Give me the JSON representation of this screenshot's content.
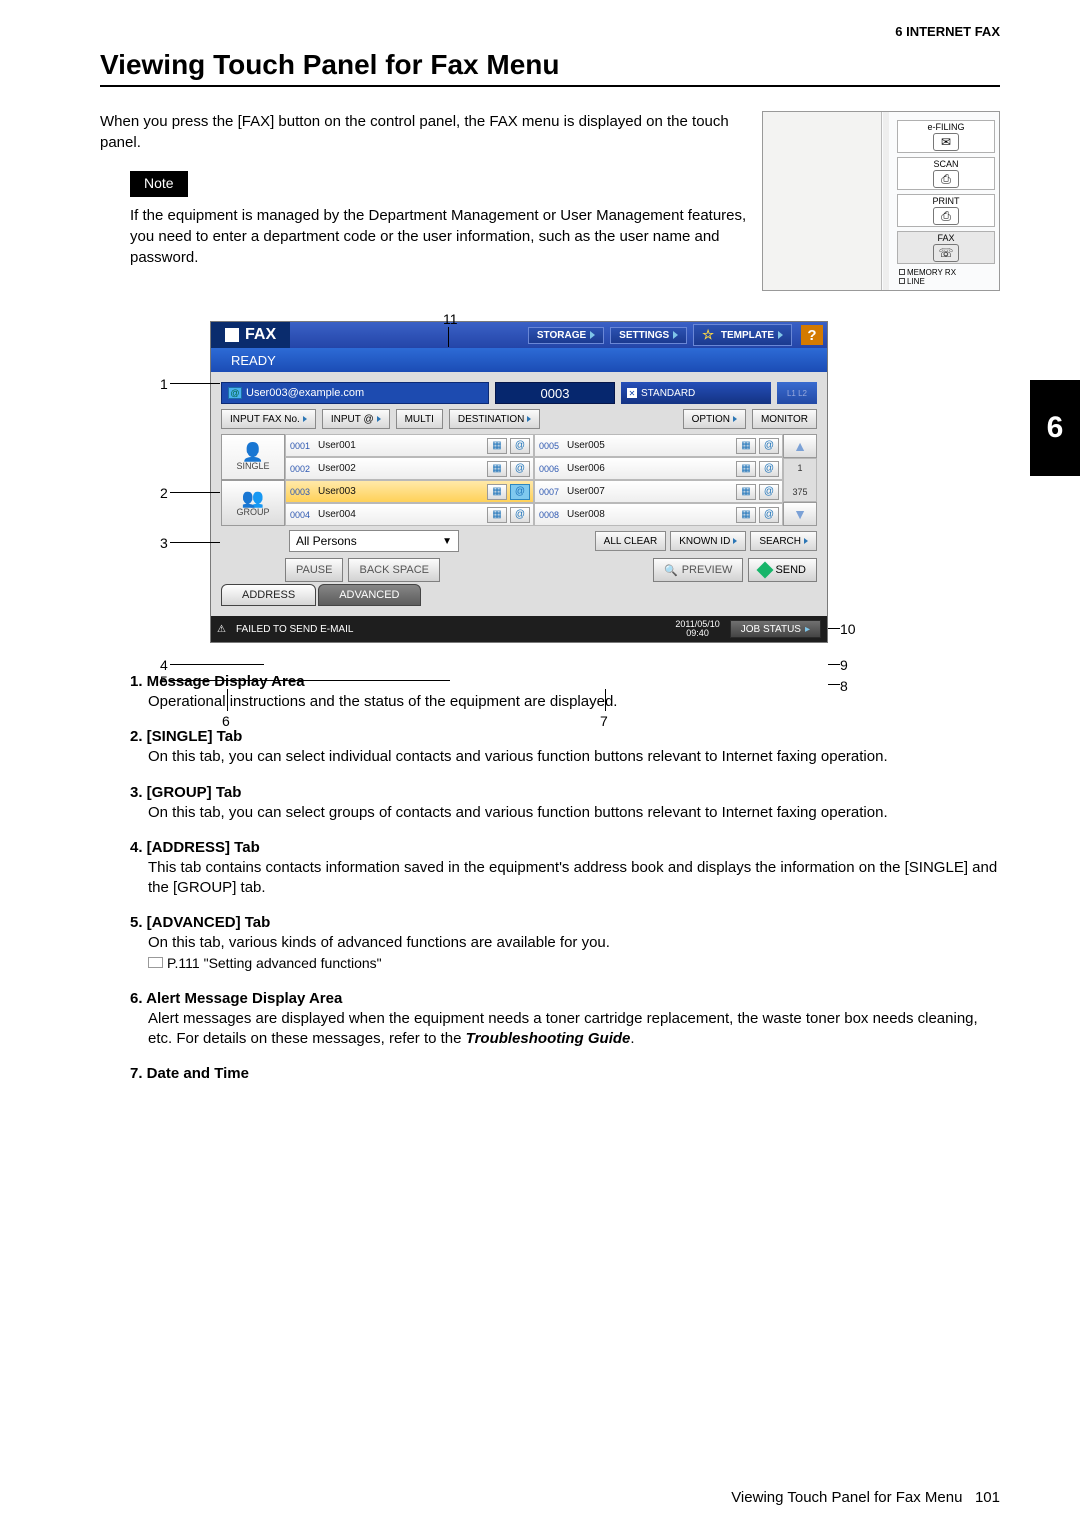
{
  "header": {
    "chapter_label": "6 INTERNET FAX",
    "chapter_tab": "6"
  },
  "heading": "Viewing Touch Panel for Fax Menu",
  "intro": "When you press the [FAX] button on the control panel, the FAX menu is displayed on the touch panel.",
  "note": {
    "label": "Note",
    "body": "If the equipment is managed by the Department Management or User Management features, you need to enter a department code or the user information, such as the user name and password."
  },
  "mini_panel": {
    "items": [
      "e-FILING",
      "SCAN",
      "PRINT",
      "FAX"
    ],
    "lines": [
      "MEMORY RX",
      "LINE"
    ]
  },
  "callouts": {
    "c1": "1",
    "c2": "2",
    "c3": "3",
    "c4": "4",
    "c5": "5",
    "c6": "6",
    "c7": "7",
    "c8": "8",
    "c9": "9",
    "c10": "10",
    "c11": "11"
  },
  "shot": {
    "title": "FAX",
    "toolbar": {
      "storage": "STORAGE",
      "settings": "SETTINGS",
      "template": "TEMPLATE",
      "help": "?"
    },
    "ready": "READY",
    "dest": {
      "email": "User003@example.com",
      "count": "0003",
      "standard": "STANDARD",
      "l12": "L1 L2"
    },
    "row_btns": {
      "input_fax": "INPUT FAX No.",
      "input_at": "INPUT @",
      "multi": "MULTI",
      "destination": "DESTINATION",
      "option": "OPTION",
      "monitor": "MONITOR"
    },
    "side_tabs": {
      "single": "SINGLE",
      "group": "GROUP"
    },
    "contacts_left": [
      {
        "num": "0001",
        "name": "User001"
      },
      {
        "num": "0002",
        "name": "User002"
      },
      {
        "num": "0003",
        "name": "User003",
        "selected": true
      },
      {
        "num": "0004",
        "name": "User004"
      }
    ],
    "contacts_right": [
      {
        "num": "0005",
        "name": "User005"
      },
      {
        "num": "0006",
        "name": "User006"
      },
      {
        "num": "0007",
        "name": "User007"
      },
      {
        "num": "0008",
        "name": "User008"
      }
    ],
    "scroll": {
      "top": "1",
      "bottom": "375"
    },
    "persons": "All Persons",
    "persons_btns": {
      "allclear": "ALL CLEAR",
      "knownid": "KNOWN ID",
      "search": "SEARCH"
    },
    "send": {
      "pause": "PAUSE",
      "backspace": "BACK SPACE",
      "preview": "PREVIEW",
      "send": "SEND"
    },
    "bottom_tabs": {
      "address": "ADDRESS",
      "advanced": "ADVANCED"
    },
    "status": {
      "msg": "FAILED TO SEND E-MAIL",
      "date": "2011/05/10",
      "time": "09:40",
      "job": "JOB STATUS"
    }
  },
  "desc": [
    {
      "t": "1. Message Display Area",
      "b": "Operational instructions and the status of the equipment are displayed."
    },
    {
      "t": "2. [SINGLE] Tab",
      "b": "On this tab, you can select individual contacts and various function buttons relevant to Internet faxing operation."
    },
    {
      "t": "3. [GROUP] Tab",
      "b": "On this tab, you can select groups of contacts and various function buttons relevant to Internet faxing operation."
    },
    {
      "t": "4. [ADDRESS] Tab",
      "b": "This tab contains contacts information saved in the equipment's address book and displays the information on the [SINGLE] and the [GROUP] tab."
    },
    {
      "t": "5. [ADVANCED] Tab",
      "b": "On this tab, various kinds of advanced functions are available for you.",
      "ref": "P.111 \"Setting advanced functions\""
    },
    {
      "t": "6. Alert Message Display Area",
      "b": "Alert messages are displayed when the equipment needs a toner cartridge replacement, the waste toner box needs cleaning, etc. For details on these messages, refer to the ",
      "tg": "Troubleshooting Guide",
      "after": "."
    },
    {
      "t": "7. Date and Time",
      "b": ""
    }
  ],
  "footer": {
    "title": "Viewing Touch Panel for Fax Menu",
    "page": "101"
  }
}
